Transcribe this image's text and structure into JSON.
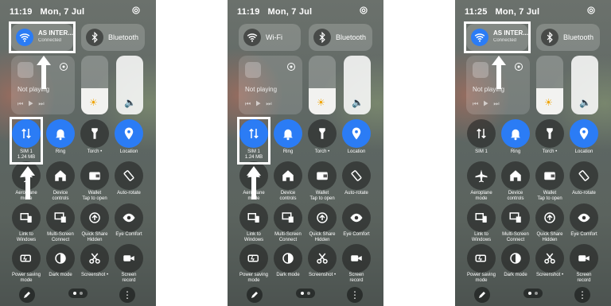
{
  "screens": [
    {
      "status": {
        "time": "11:19",
        "date": "Mon, 7 Jul"
      },
      "wifi": {
        "title": "AS INTER...",
        "subtitle": "Connected"
      },
      "bluetooth": {
        "title": "Bluetooth"
      },
      "media": {
        "label": "Not playing"
      },
      "toggles": [
        "SIM 1\n1.24 MB",
        "Ring",
        "Torch •",
        "Location",
        "Aeroplane\nmode",
        "Device\ncontrols",
        "Wallet\nTap to open",
        "Auto-rotate",
        "Link to\nWindows",
        "Multi-Screen\nConnect",
        "Quick Share\nHidden",
        "Eye Comfort",
        "Power saving\nmode",
        "Dark mode",
        "Screenshot •",
        "Screen\nrecord"
      ]
    },
    {
      "status": {
        "time": "11:19",
        "date": "Mon, 7 Jul"
      },
      "wifi": {
        "title": "Wi-Fi",
        "subtitle": ""
      },
      "bluetooth": {
        "title": "Bluetooth"
      },
      "media": {
        "label": "Not playing"
      },
      "toggles": [
        "SIM 1\n1.24 MB",
        "Ring",
        "Torch •",
        "Location",
        "Aeroplane\nmode",
        "Device\ncontrols",
        "Wallet\nTap to open",
        "Auto-rotate",
        "Link to\nWindows",
        "Multi-Screen\nConnect",
        "Quick Share\nHidden",
        "Eye Comfort",
        "Power saving\nmode",
        "Dark mode",
        "Screenshot •",
        "Screen\nrecord"
      ]
    },
    {
      "status": {
        "time": "11:25",
        "date": "Mon, 7 Jul"
      },
      "wifi": {
        "title": "AS INTER...",
        "subtitle": "Connected"
      },
      "bluetooth": {
        "title": "Bluetooth"
      },
      "media": {
        "label": "Not playing"
      },
      "toggles": [
        "SIM 1",
        "Ring",
        "Torch •",
        "Location",
        "Aeroplane\nmode",
        "Device\ncontrols",
        "Wallet\nTap to open",
        "Auto-rotate",
        "Link to\nWindows",
        "Multi-Screen\nConnect",
        "Quick Share\nHidden",
        "Eye Comfort",
        "Power saving\nmode",
        "Dark mode",
        "Screenshot •",
        "Screen\nrecord"
      ]
    }
  ],
  "sliders": {
    "brightness_level": 0.45,
    "volume_level": 1.0
  },
  "colors": {
    "accent": "#2b7cf5",
    "highlight": "#ffffff"
  }
}
